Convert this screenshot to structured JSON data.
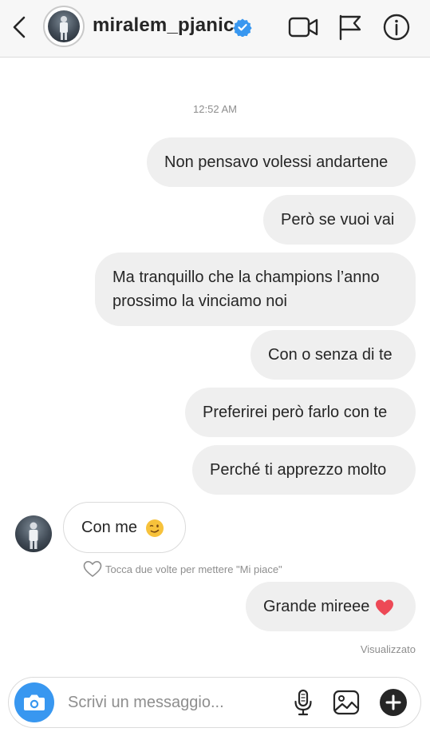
{
  "header": {
    "username": "miralem_pjanic",
    "icons": [
      "back-chevron-icon",
      "verified-badge-icon",
      "video-call-icon",
      "flag-icon",
      "info-icon"
    ]
  },
  "thread": {
    "timestamp": "12:52 AM",
    "messages": [
      {
        "from": "me",
        "text": "Non pensavo volessi andartene"
      },
      {
        "from": "me",
        "text": "Però se vuoi vai"
      },
      {
        "from": "me",
        "text": "Ma tranquillo che la champions l’anno prossimo la vinciamo noi"
      },
      {
        "from": "me",
        "text": "Con o senza di te"
      },
      {
        "from": "me",
        "text": "Preferirei però farlo con te"
      },
      {
        "from": "me",
        "text": "Perché ti apprezzo molto"
      },
      {
        "from": "them",
        "text": "Con me",
        "emoji": "winking-face-emoji"
      },
      {
        "from": "me",
        "text": "Grande mireee",
        "emoji": "red-heart-emoji"
      }
    ],
    "like_hint": "Tocca due volte per mettere \"Mi piace\"",
    "seen_label": "Visualizzato"
  },
  "composer": {
    "placeholder": "Scrivi un messaggio...",
    "icons": [
      "camera-icon",
      "microphone-icon",
      "gallery-icon",
      "plus-icon"
    ]
  },
  "colors": {
    "accent": "#3897f0",
    "verified": "#3897f0",
    "heart": "#ed4956",
    "bubble_out": "#efefef",
    "muted_text": "#8e8e8e"
  }
}
